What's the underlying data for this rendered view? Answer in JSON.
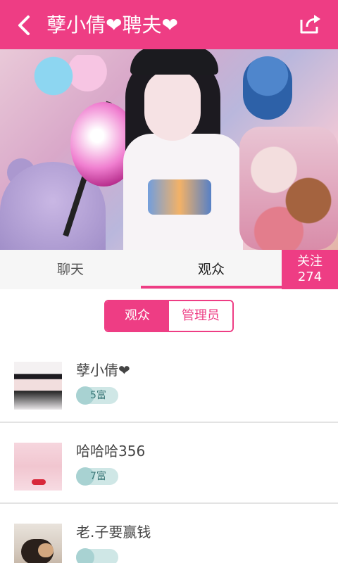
{
  "header": {
    "title": "孽小倩❤聘夫❤",
    "back_icon": "chevron-left-icon",
    "share_icon": "share-icon",
    "bg_color": "#ee3d84"
  },
  "tabs": {
    "chat_label": "聊天",
    "audience_label": "观众",
    "follow_label": "关注",
    "follow_count": "274"
  },
  "segment": {
    "audience_label": "观众",
    "admin_label": "管理员"
  },
  "audience": [
    {
      "name": "孽小倩❤",
      "rank": "5富"
    },
    {
      "name": "哈哈哈356",
      "rank": "7富"
    },
    {
      "name": "老.子要赢钱",
      "rank": ""
    }
  ],
  "colors": {
    "accent": "#ee3d84",
    "badge": "#cfe7e6"
  }
}
